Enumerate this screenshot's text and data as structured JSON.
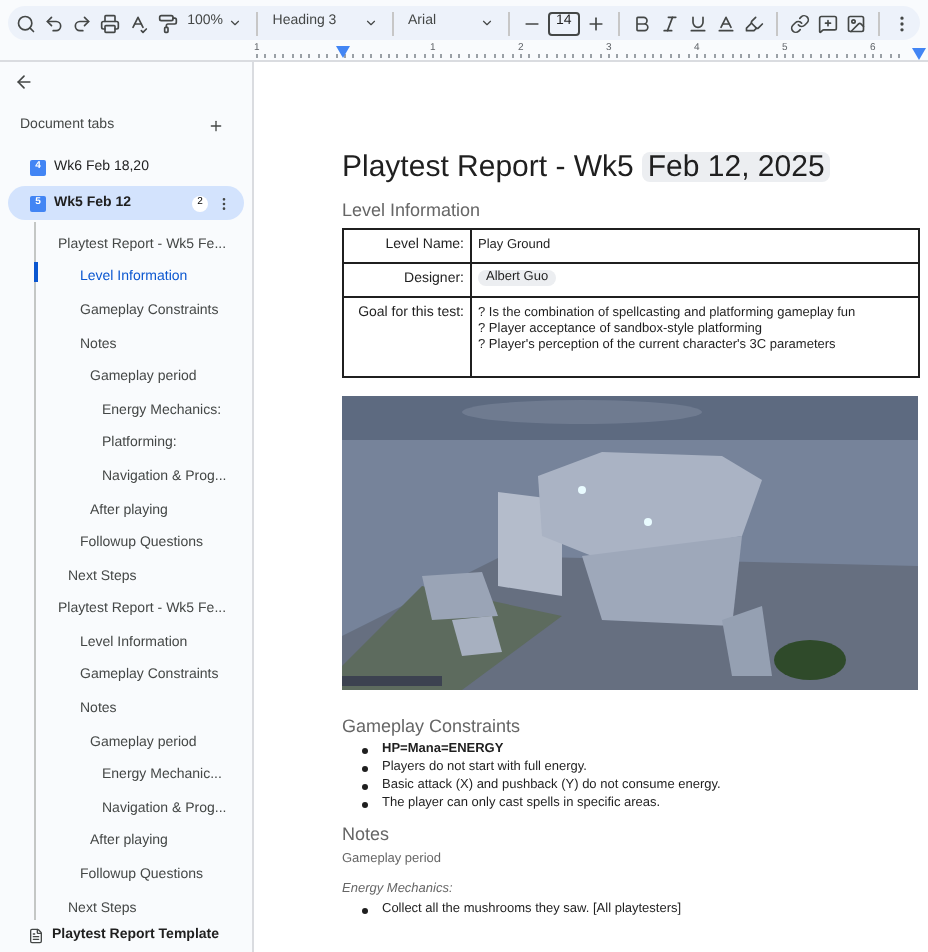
{
  "toolbar": {
    "zoom": "100%",
    "style": "Heading 3",
    "font": "Arial",
    "font_size": "14"
  },
  "ruler": [
    "1",
    "1",
    "2",
    "3",
    "4",
    "5",
    "6"
  ],
  "sidebar": {
    "heading": "Document tabs",
    "tabs": [
      {
        "number": "4",
        "label": "Wk6 Feb 18,20",
        "selected": false
      },
      {
        "number": "5",
        "label": "Wk5 Feb 12",
        "selected": true,
        "badge": "2"
      }
    ],
    "outline": [
      {
        "kind": "title",
        "label": "Playtest Report - Wk5 Fe...",
        "selected": false,
        "children": [
          {
            "kind": "h2",
            "label": "Level Information",
            "selected": true
          },
          {
            "kind": "h2",
            "label": "Gameplay Constraints",
            "selected": false
          },
          {
            "kind": "h2",
            "label": "Notes",
            "selected": false,
            "children": [
              {
                "kind": "h3",
                "label": "Gameplay period",
                "selected": false,
                "children": [
                  {
                    "kind": "h4",
                    "label": "Energy Mechanics:",
                    "selected": false
                  },
                  {
                    "kind": "h4",
                    "label": "Platforming:",
                    "selected": false
                  },
                  {
                    "kind": "h4",
                    "label": "Navigation & Prog...",
                    "selected": false
                  }
                ]
              },
              {
                "kind": "h3",
                "label": "After playing",
                "selected": false
              }
            ]
          },
          {
            "kind": "h2",
            "label": "Followup Questions",
            "selected": false
          },
          {
            "kind": "h1",
            "label": "Next Steps",
            "selected": false
          }
        ]
      },
      {
        "kind": "title",
        "label": "Playtest Report - Wk5 Fe...",
        "selected": false,
        "children": [
          {
            "kind": "h2",
            "label": "Level Information",
            "selected": false
          },
          {
            "kind": "h2",
            "label": "Gameplay Constraints",
            "selected": false
          },
          {
            "kind": "h2",
            "label": "Notes",
            "selected": false,
            "children": [
              {
                "kind": "h3",
                "label": "Gameplay period",
                "selected": false,
                "children": [
                  {
                    "kind": "h4",
                    "label": "Energy Mechanic...",
                    "selected": false
                  },
                  {
                    "kind": "h4",
                    "label": "Navigation & Prog...",
                    "selected": false
                  }
                ]
              },
              {
                "kind": "h3",
                "label": "After playing",
                "selected": false
              }
            ]
          },
          {
            "kind": "h2",
            "label": "Followup Questions",
            "selected": false
          },
          {
            "kind": "h1",
            "label": "Next Steps",
            "selected": false
          }
        ]
      }
    ],
    "other_tabs": [
      {
        "label": "Playtest Report Template"
      }
    ]
  },
  "document": {
    "title": "Playtest Report - Wk5",
    "date": "Feb 12, 2025",
    "level_heading": "Level Information",
    "table": [
      {
        "kind": "text",
        "label": "Level Name:",
        "value": "Play Ground"
      },
      {
        "kind": "chip",
        "label": "Designer:",
        "value": "Albert Guo"
      },
      {
        "kind": "lines",
        "label": "Goal for this test:",
        "lines": [
          "? Is the combination of spellcasting and platforming gameplay fun",
          "? Player acceptance of sandbox-style platforming",
          "? Player's perception of the current character's 3C parameters"
        ]
      }
    ],
    "constraints_heading": "Gameplay Constraints",
    "constraints": [
      "HP=Mana=ENERGY",
      "Players do not start with full energy.",
      "Basic attack (X) and pushback (Y) do not consume energy.",
      "The player can only cast spells in specific areas."
    ],
    "notes_heading": "Notes",
    "period": "Gameplay period",
    "energy": "Energy Mechanics:",
    "energy_items": [
      "Collect all the mushrooms they saw. [All playtesters]"
    ]
  }
}
